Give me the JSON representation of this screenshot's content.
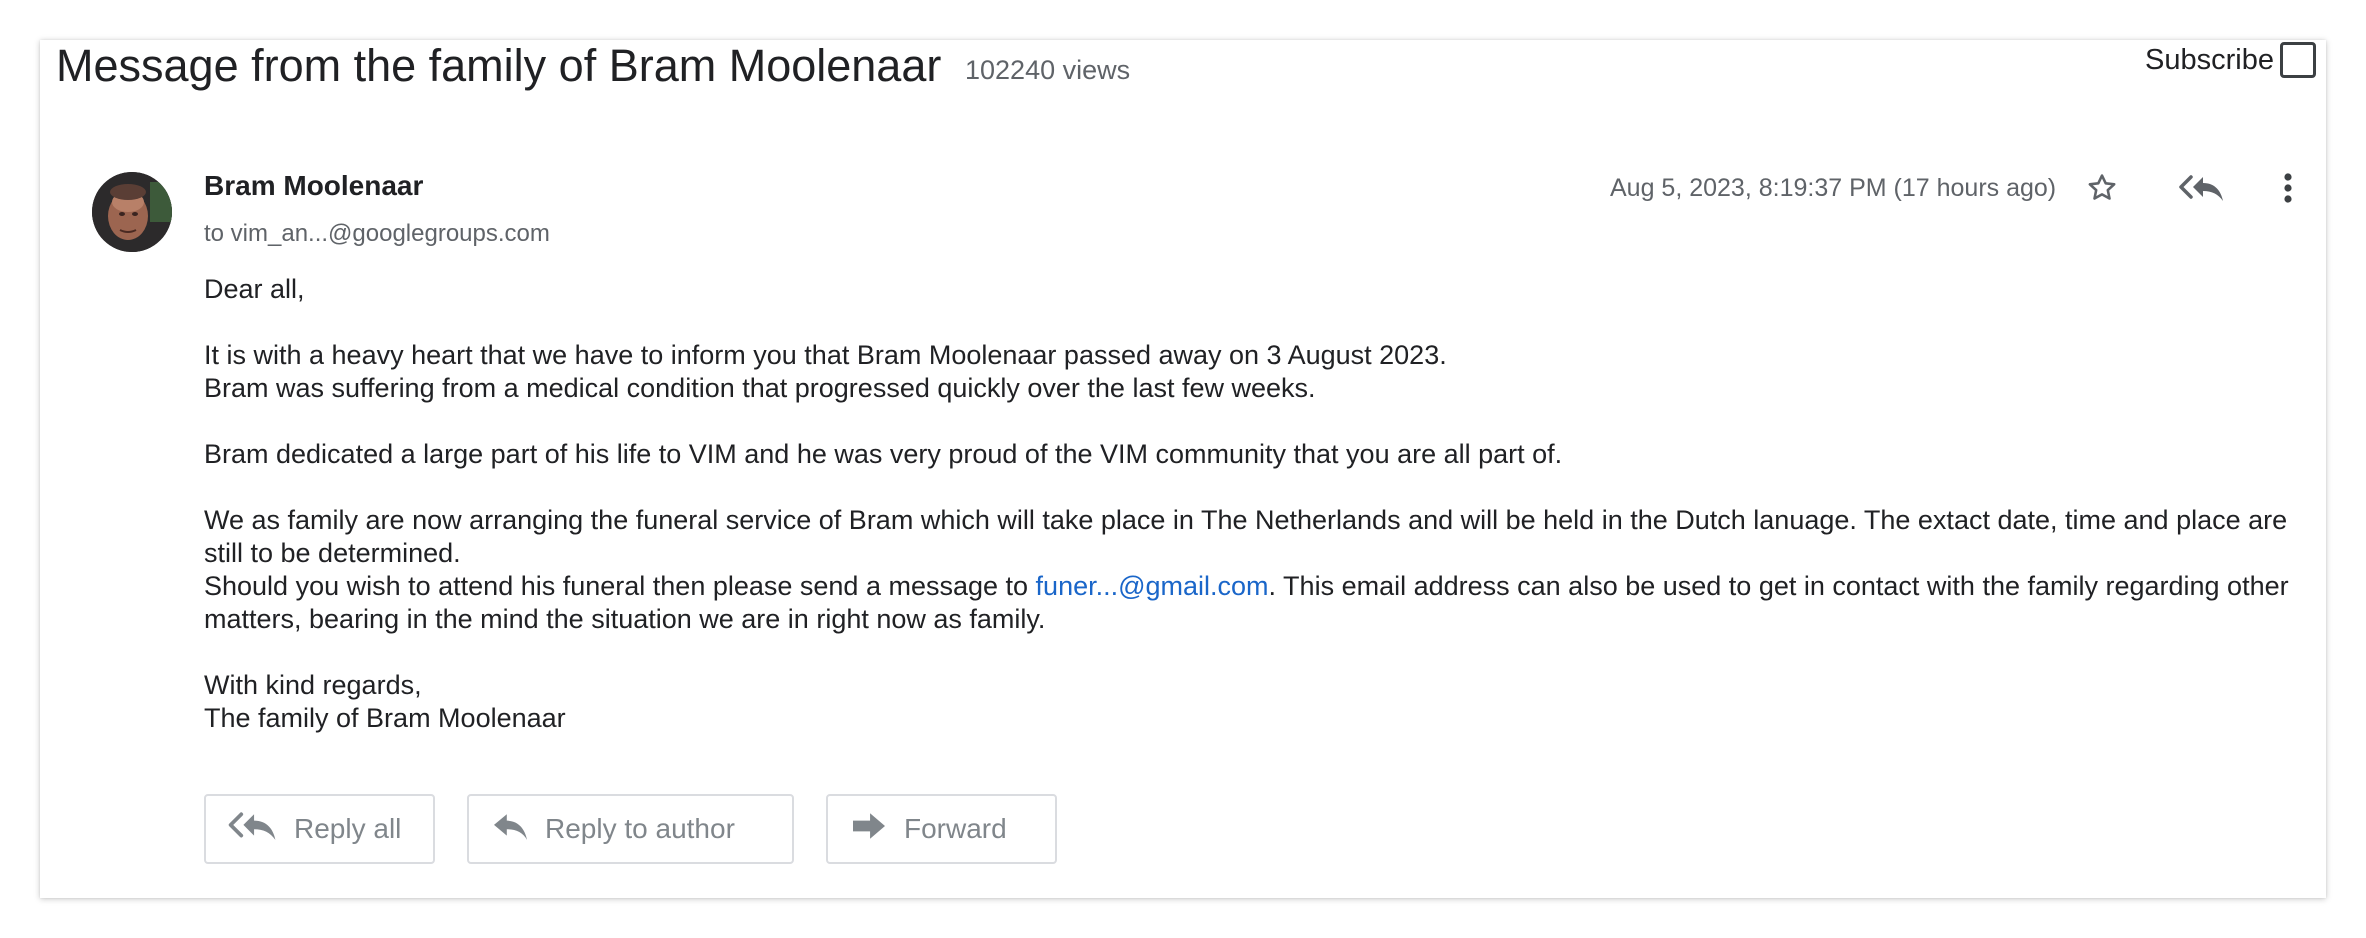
{
  "thread": {
    "title": "Message from the family of Bram Moolenaar",
    "views": "102240 views",
    "subscribe_label": "Subscribe"
  },
  "message": {
    "author": "Bram Moolenaar",
    "to": "to vim_an...@googlegroups.com",
    "date": "Aug 5, 2023, 8:19:37 PM (17 hours ago)",
    "greeting": "Dear all,",
    "para1_line1": "It is with a heavy heart that we have to inform you that Bram Moolenaar passed away on 3 August 2023.",
    "para1_line2": "Bram was suffering from a medical condition that progressed quickly over the last few weeks.",
    "para2": "Bram dedicated a large part of his life to VIM and he was very proud of the VIM community that you are all part of.",
    "para3_line1": "We as family are now arranging the funeral service of Bram which will take place in The Netherlands and will be held in the Dutch lanuage. The extact date, time and place are still to be determined.",
    "para3_line2_before": "Should you wish to attend his funeral then please send a message to ",
    "email_link": "funer...@gmail.com",
    "para3_line2_after": ". This email address can also be used to get in contact with the family regarding other matters, bearing in the mind the situation we are in right now as family.",
    "closing": "With kind regards,",
    "signature": "The family of Bram Moolenaar"
  },
  "actions": {
    "reply_all": "Reply all",
    "reply_to_author": "Reply to author",
    "forward": "Forward"
  },
  "icons": {
    "star": "star-outline-icon",
    "reply_all_header": "reply-all-icon",
    "more": "more-vert-icon"
  },
  "colors": {
    "link": "#1a66c9",
    "text": "#202124",
    "secondary": "#5f6368",
    "button_text": "#80868b"
  }
}
